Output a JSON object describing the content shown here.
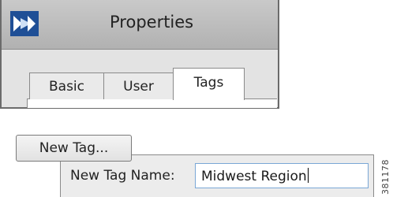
{
  "window": {
    "title": "Properties",
    "tabs": [
      {
        "label": "Basic",
        "selected": false
      },
      {
        "label": "User",
        "selected": false
      },
      {
        "label": "Tags",
        "selected": true
      }
    ]
  },
  "new_tag_button": {
    "label": "New Tag..."
  },
  "new_tag_form": {
    "label": "New Tag Name:",
    "value": "Midwest Region"
  },
  "figure_id": "381178",
  "colors": {
    "title_bar": "#bcbcbc",
    "tab_area": "#e3e3e3",
    "input_border": "#7aa7d6",
    "icon_blue": "#2a5fa8"
  },
  "icons": {
    "app": "app-logo-icon"
  }
}
